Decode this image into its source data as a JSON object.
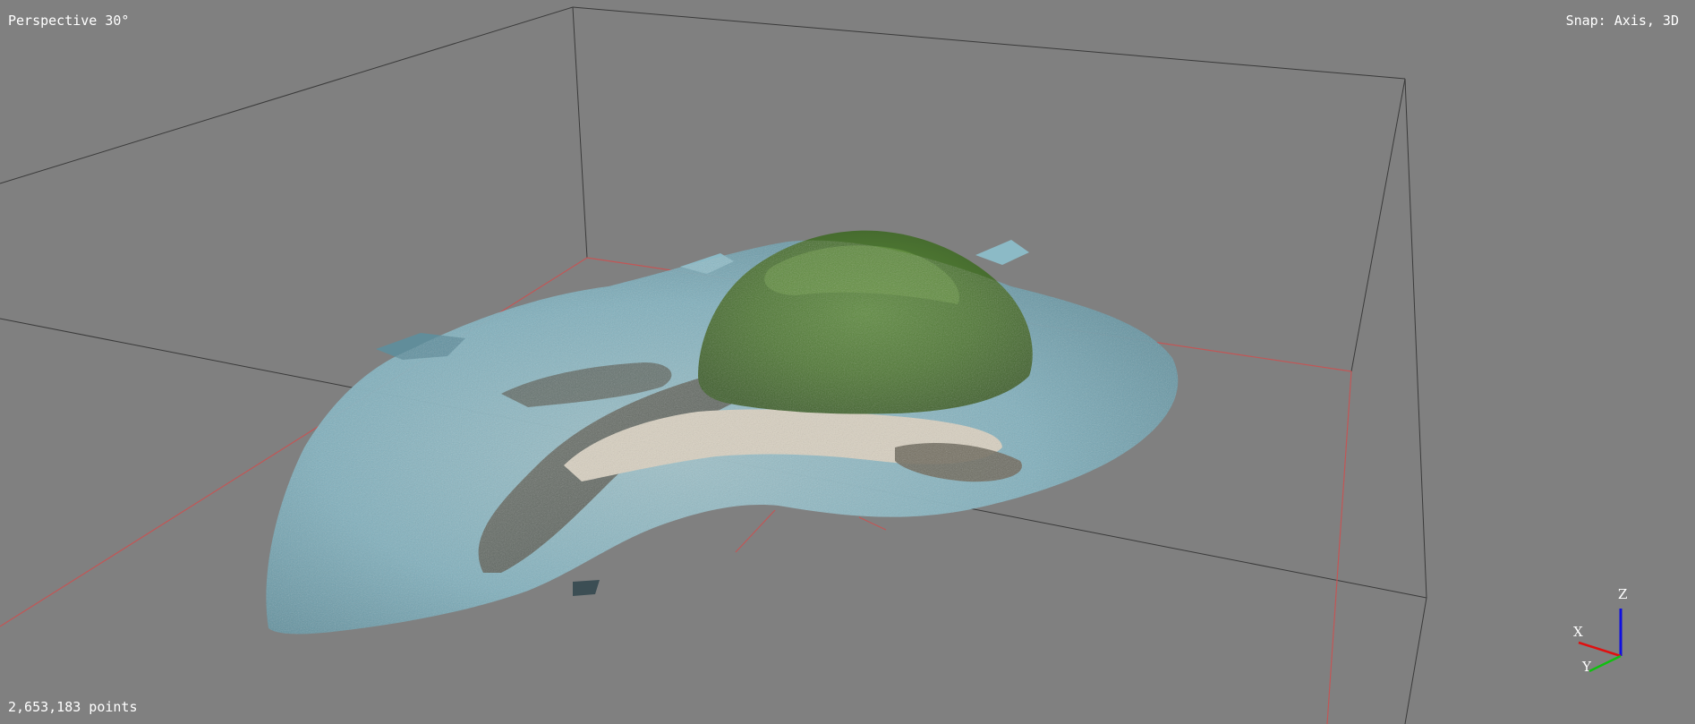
{
  "viewport": {
    "projection": "Perspective 30°",
    "snap": "Snap: Axis, 3D",
    "point_count": "2,653,183 points",
    "background_color": "#808080"
  },
  "bounding_box": {
    "edge_color": "#3a3a3a",
    "ground_grid_color": "#c25656"
  },
  "axis_gizmo": {
    "x_label": "X",
    "y_label": "Y",
    "z_label": "Z",
    "x_color": "#e01010",
    "y_color": "#10c010",
    "z_color": "#1010e0"
  },
  "point_cloud": {
    "subject": "island",
    "vegetation_color": "#4f7a38",
    "water_color": "#7fb2c0",
    "sand_color": "#d8d0c0",
    "rock_color": "#5a5a52"
  }
}
